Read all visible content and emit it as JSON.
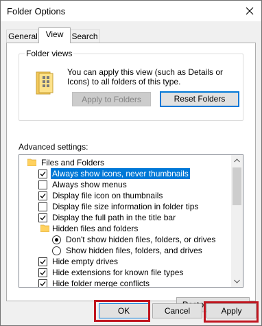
{
  "window": {
    "title": "Folder Options"
  },
  "tabs": [
    {
      "label": "General",
      "active": false
    },
    {
      "label": "View",
      "active": true
    },
    {
      "label": "Search",
      "active": false
    }
  ],
  "folder_views": {
    "group_label": "Folder views",
    "description": "You can apply this view (such as Details or Icons) to all folders of this type.",
    "apply_button": "Apply to Folders",
    "reset_button": "Reset Folders"
  },
  "advanced": {
    "label": "Advanced settings:",
    "items": [
      {
        "type": "folder",
        "label": "Files and Folders"
      },
      {
        "type": "checkbox",
        "label": "Always show icons, never thumbnails",
        "checked": true,
        "selected": true
      },
      {
        "type": "checkbox",
        "label": "Always show menus",
        "checked": false
      },
      {
        "type": "checkbox",
        "label": "Display file icon on thumbnails",
        "checked": true
      },
      {
        "type": "checkbox",
        "label": "Display file size information in folder tips",
        "checked": false
      },
      {
        "type": "checkbox",
        "label": "Display the full path in the title bar",
        "checked": true
      },
      {
        "type": "folder",
        "label": "Hidden files and folders"
      },
      {
        "type": "radio",
        "label": "Don't show hidden files, folders, or drives",
        "checked": true
      },
      {
        "type": "radio",
        "label": "Show hidden files, folders, and drives",
        "checked": false
      },
      {
        "type": "checkbox",
        "label": "Hide empty drives",
        "checked": true
      },
      {
        "type": "checkbox",
        "label": "Hide extensions for known file types",
        "checked": true
      },
      {
        "type": "checkbox",
        "label": "Hide folder merge conflicts",
        "checked": true
      }
    ]
  },
  "buttons": {
    "restore_defaults": "Restore Defaults",
    "ok": "OK",
    "cancel": "Cancel",
    "apply": "Apply"
  },
  "colors": {
    "selection": "#0078d7",
    "highlight_box": "#c0151f",
    "folder": "#ffd15e"
  }
}
